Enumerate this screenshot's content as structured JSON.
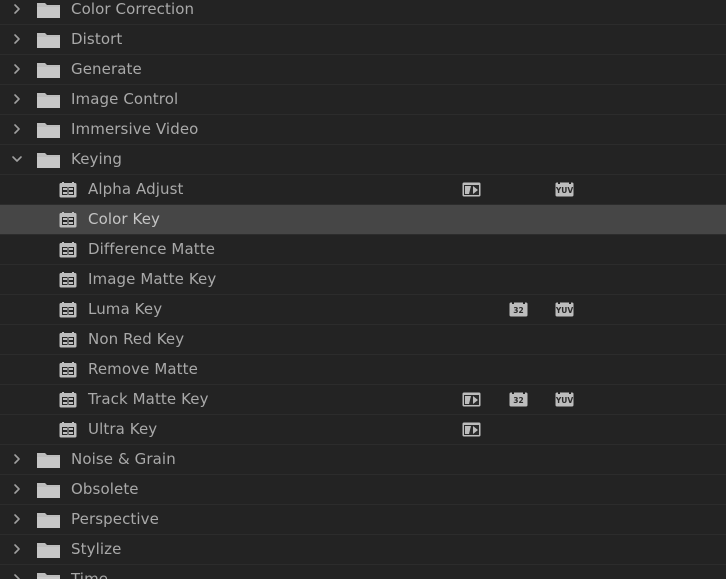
{
  "effects_panel": {
    "rows": [
      {
        "kind": "bin",
        "label": "Color Correction",
        "expanded": false,
        "icon": "folder-icon"
      },
      {
        "kind": "bin",
        "label": "Distort",
        "expanded": false,
        "icon": "folder-icon"
      },
      {
        "kind": "bin",
        "label": "Generate",
        "expanded": false,
        "icon": "folder-icon"
      },
      {
        "kind": "bin",
        "label": "Image Control",
        "expanded": false,
        "icon": "folder-icon"
      },
      {
        "kind": "bin",
        "label": "Immersive Video",
        "expanded": false,
        "icon": "folder-icon"
      },
      {
        "kind": "bin",
        "label": "Keying",
        "expanded": true,
        "icon": "folder-icon"
      },
      {
        "kind": "effect",
        "label": "Alpha Adjust",
        "selected": false,
        "accelerated": true,
        "bit32": false,
        "yuv": true
      },
      {
        "kind": "effect",
        "label": "Color Key",
        "selected": true,
        "accelerated": false,
        "bit32": false,
        "yuv": false
      },
      {
        "kind": "effect",
        "label": "Difference Matte",
        "selected": false,
        "accelerated": false,
        "bit32": false,
        "yuv": false
      },
      {
        "kind": "effect",
        "label": "Image Matte Key",
        "selected": false,
        "accelerated": false,
        "bit32": false,
        "yuv": false
      },
      {
        "kind": "effect",
        "label": "Luma Key",
        "selected": false,
        "accelerated": false,
        "bit32": true,
        "yuv": true
      },
      {
        "kind": "effect",
        "label": "Non Red Key",
        "selected": false,
        "accelerated": false,
        "bit32": false,
        "yuv": false
      },
      {
        "kind": "effect",
        "label": "Remove Matte",
        "selected": false,
        "accelerated": false,
        "bit32": false,
        "yuv": false
      },
      {
        "kind": "effect",
        "label": "Track Matte Key",
        "selected": false,
        "accelerated": true,
        "bit32": true,
        "yuv": true
      },
      {
        "kind": "effect",
        "label": "Ultra Key",
        "selected": false,
        "accelerated": true,
        "bit32": false,
        "yuv": false
      },
      {
        "kind": "bin",
        "label": "Noise & Grain",
        "expanded": false,
        "icon": "folder-icon"
      },
      {
        "kind": "bin",
        "label": "Obsolete",
        "expanded": false,
        "icon": "folder-icon"
      },
      {
        "kind": "bin",
        "label": "Perspective",
        "expanded": false,
        "icon": "folder-icon"
      },
      {
        "kind": "bin",
        "label": "Stylize",
        "expanded": false,
        "icon": "folder-icon"
      },
      {
        "kind": "bin",
        "label": "Time",
        "expanded": false,
        "icon": "folder-icon"
      }
    ]
  },
  "badges": {
    "accelerated_icon": "accelerated-effect-icon",
    "bit32_text": "32",
    "yuv_text": "YUV"
  },
  "colors": {
    "background": "#232323",
    "selected_row": "#464646",
    "text": "#a9a9a9",
    "icon": "#bdbdbd"
  }
}
